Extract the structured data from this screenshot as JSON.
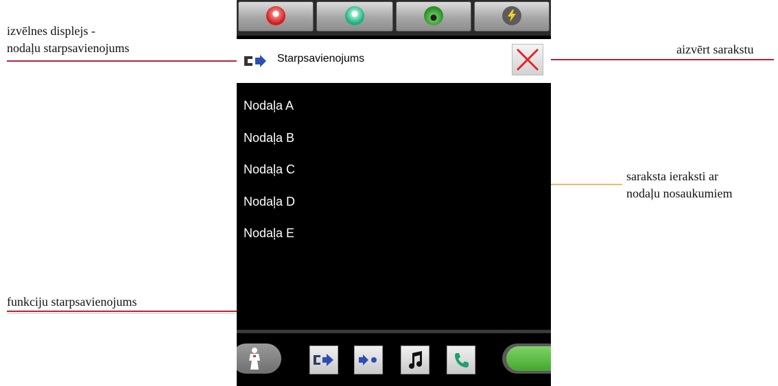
{
  "annotations": {
    "menu_display_line1": "izvēlnes displejs -",
    "menu_display_line2": "nodaļu starpsavienojums",
    "close_list": "aizvērt sarakstu",
    "list_entries_line1": "saraksta ieraksti ar",
    "list_entries_line2": "nodaļu nosaukumiem",
    "function_intercom": "funkciju starpsavienojums"
  },
  "header": {
    "title": "Starpsavienojums",
    "icon": "intercom-arrow-icon",
    "close_icon": "close-x-icon"
  },
  "list": {
    "items": [
      "Nodaļa A",
      "Nodaļa B",
      "Nodaļa C",
      "Nodaļa D",
      "Nodaļa E"
    ]
  },
  "top_buttons": [
    {
      "icon": "red-alarm-icon",
      "color": "#d21d1d"
    },
    {
      "icon": "teal-presence-icon",
      "color": "#1fae7d"
    },
    {
      "icon": "green-status-icon",
      "color": "#2e8f2a"
    },
    {
      "icon": "lightning-icon",
      "color": "#f2d21b"
    }
  ],
  "bottom_buttons": [
    {
      "icon": "nurse-icon"
    },
    {
      "icon": "intercom-arrow-icon"
    },
    {
      "icon": "forward-dot-icon"
    },
    {
      "icon": "music-note-icon"
    },
    {
      "icon": "phone-icon"
    },
    {
      "icon": "green-toggle-icon"
    }
  ],
  "colors": {
    "leader_red": "#b0243a",
    "leader_orange": "#f5b66a",
    "close_red": "#e0262a",
    "icon_blue": "#2b4fb3"
  }
}
